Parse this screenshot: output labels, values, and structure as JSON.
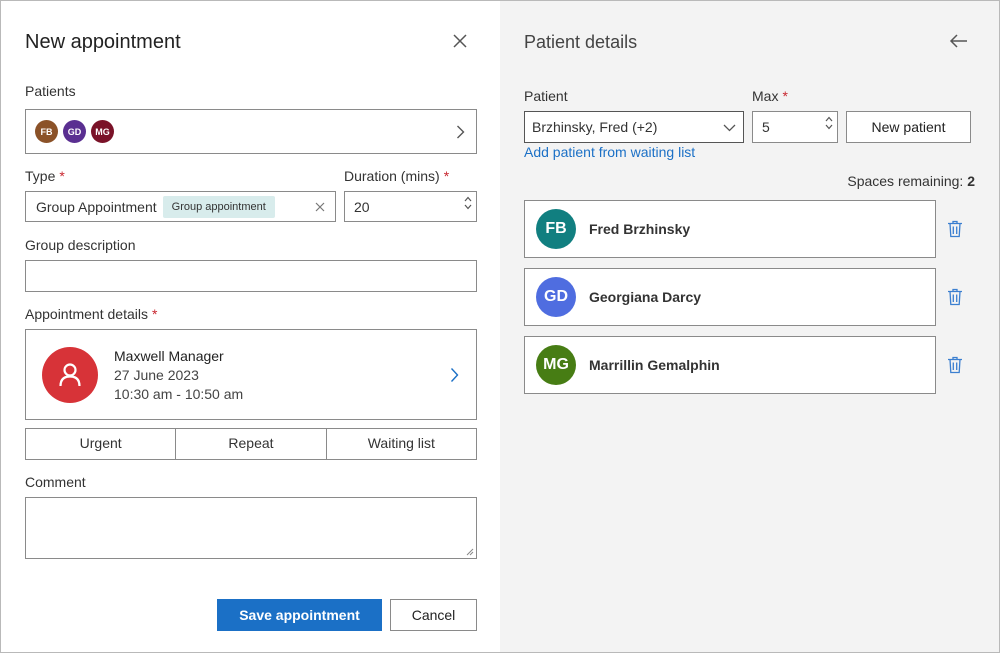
{
  "left": {
    "title": "New appointment",
    "patients_label": "Patients",
    "patients": [
      {
        "initials": "FB",
        "color": "#8b5228"
      },
      {
        "initials": "GD",
        "color": "#5a2f91"
      },
      {
        "initials": "MG",
        "color": "#7a1228"
      }
    ],
    "type_label": "Type",
    "type_value": "Group Appointment",
    "type_chip": "Group appointment",
    "duration_label": "Duration (mins)",
    "duration_value": "20",
    "group_desc_label": "Group description",
    "group_desc_value": "",
    "appt_details_label": "Appointment details",
    "clinician_name": "Maxwell Manager",
    "appt_date": "27 June 2023",
    "appt_time": "10:30 am - 10:50 am",
    "clinician_avatar_color": "#d73338",
    "toggles": [
      "Urgent",
      "Repeat",
      "Waiting list"
    ],
    "comment_label": "Comment",
    "comment_value": "",
    "save_label": "Save appointment",
    "cancel_label": "Cancel",
    "required_mark": "*"
  },
  "right": {
    "title": "Patient details",
    "patient_label": "Patient",
    "patient_select_value": "Brzhinsky, Fred (+2)",
    "max_label": "Max",
    "max_value": "5",
    "new_patient_label": "New patient",
    "add_waiting_link": "Add patient from waiting list",
    "spaces_label": "Spaces remaining:",
    "spaces_value": "2",
    "patients": [
      {
        "initials": "FB",
        "name": "Fred Brzhinsky",
        "color": "#117f80"
      },
      {
        "initials": "GD",
        "name": "Georgiana Darcy",
        "color": "#4f6de0"
      },
      {
        "initials": "MG",
        "name": "Marrillin Gemalphin",
        "color": "#477d14"
      }
    ]
  },
  "colors": {
    "accent": "#1b70c6",
    "required": "#c8262f",
    "panel_bg": "#f3f3f3"
  },
  "icons": [
    "close-icon",
    "back-arrow-icon",
    "chevron-right-icon",
    "chevron-down-icon",
    "clear-icon",
    "user-icon",
    "trash-icon",
    "stepper-up-icon",
    "stepper-down-icon",
    "resize-handle-icon"
  ]
}
